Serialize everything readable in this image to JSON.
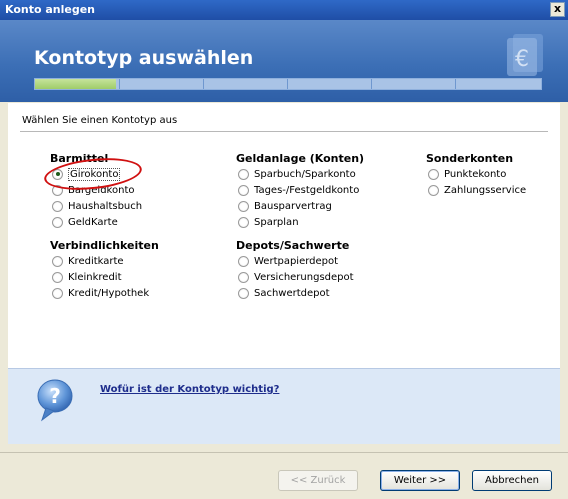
{
  "window": {
    "title": "Konto anlegen",
    "close_label": "x"
  },
  "header": {
    "title": "Kontotyp auswählen",
    "progress": 0.16
  },
  "instruction": "Wählen Sie einen Kontotyp aus",
  "groups": {
    "barmittel": {
      "title": "Barmittel",
      "options": [
        "Girokonto",
        "Bargeldkonto",
        "Haushaltsbuch",
        "GeldKarte"
      ],
      "selected": "Girokonto"
    },
    "verbindlichkeiten": {
      "title": "Verbindlichkeiten",
      "options": [
        "Kreditkarte",
        "Kleinkredit",
        "Kredit/Hypothek"
      ]
    },
    "geldanlage": {
      "title": "Geldanlage (Konten)",
      "options": [
        "Sparbuch/Sparkonto",
        "Tages-/Festgeldkonto",
        "Bausparvertrag",
        "Sparplan"
      ]
    },
    "depots": {
      "title": "Depots/Sachwerte",
      "options": [
        "Wertpapierdepot",
        "Versicherungsdepot",
        "Sachwertdepot"
      ]
    },
    "sonderkonten": {
      "title": "Sonderkonten",
      "options": [
        "Punktekonto",
        "Zahlungsservice"
      ]
    }
  },
  "help": {
    "link_text": "Wofür ist der Kontotyp wichtig?"
  },
  "buttons": {
    "back": "<< Zurück",
    "next": "Weiter >>",
    "cancel": "Abbrechen"
  },
  "colors": {
    "header": "#3c6fb6",
    "help_bg": "#dce8f7",
    "highlight": "#d01010"
  }
}
